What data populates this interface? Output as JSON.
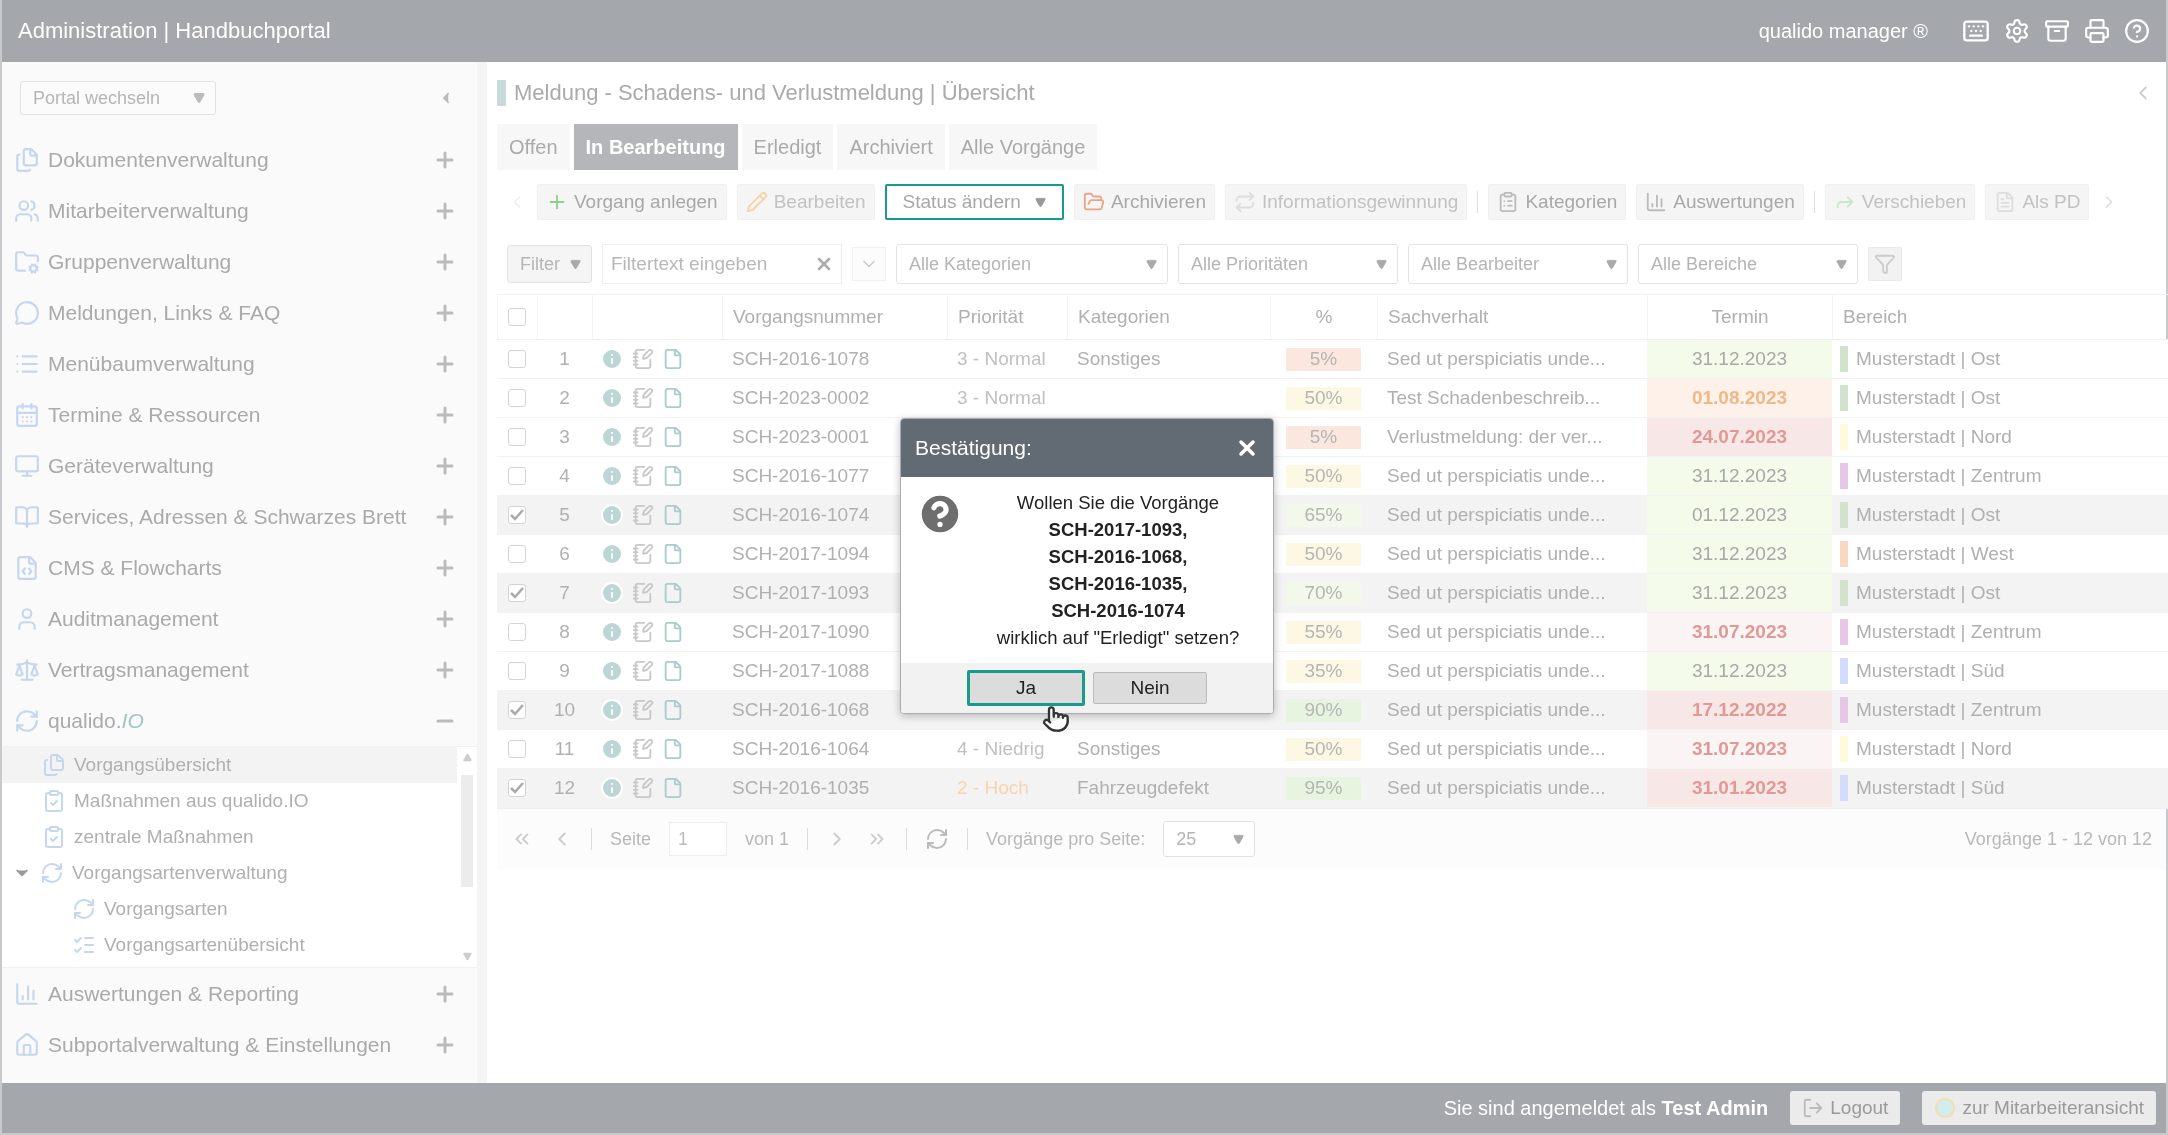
{
  "header": {
    "title": "Administration | Handbuchportal",
    "product": "qualido manager ®"
  },
  "sidebar": {
    "portal_select": "Portal wechseln",
    "items": [
      {
        "label": "Dokumentenverwaltung",
        "expanded": false
      },
      {
        "label": "Mitarbeiterverwaltung",
        "expanded": false
      },
      {
        "label": "Gruppenverwaltung",
        "expanded": false
      },
      {
        "label": "Meldungen, Links & FAQ",
        "expanded": false
      },
      {
        "label": "Menübaumverwaltung",
        "expanded": false
      },
      {
        "label": "Termine & Ressourcen",
        "expanded": false
      },
      {
        "label": "Geräteverwaltung",
        "expanded": false
      },
      {
        "label": "Services, Adressen & Schwarzes Brett",
        "expanded": false
      },
      {
        "label": "CMS & Flowcharts",
        "expanded": false
      },
      {
        "label": "Auditmanagement",
        "expanded": false
      },
      {
        "label": "Vertragsmanagement",
        "expanded": false
      },
      {
        "label": "qualido.*IO*",
        "expanded": true,
        "children": [
          {
            "label": "Vorgangsübersicht",
            "selected": true
          },
          {
            "label": "Maßnahmen aus qualido.IO",
            "selected": false
          },
          {
            "label": "zentrale Maßnahmen",
            "selected": false
          },
          {
            "label": "Vorgangsartenverwaltung",
            "selected": false,
            "expanded": true,
            "children": [
              {
                "label": "Vorgangsarten",
                "selected": false
              },
              {
                "label": "Vorgangsartenübersicht",
                "selected": false
              }
            ]
          }
        ]
      },
      {
        "label": "Auswertungen & Reporting",
        "expanded": false
      },
      {
        "label": "Subportalverwaltung & Einstellungen",
        "expanded": false
      }
    ]
  },
  "page_title": "Meldung - Schadens- und Verlustmeldung | Übersicht",
  "tabs": [
    {
      "label": "Offen",
      "selected": false
    },
    {
      "label": "In Bearbeitung",
      "selected": true
    },
    {
      "label": "Erledigt",
      "selected": false
    },
    {
      "label": "Archiviert",
      "selected": false
    },
    {
      "label": "Alle Vorgänge",
      "selected": false
    }
  ],
  "toolbar": {
    "groups": [
      [
        {
          "label": "Vorgang anlegen",
          "disabled": false,
          "focused": false,
          "dropdown": false
        },
        {
          "label": "Bearbeiten",
          "disabled": true,
          "focused": false,
          "dropdown": false
        },
        {
          "label": "Status ändern",
          "disabled": false,
          "focused": true,
          "dropdown": true
        },
        {
          "label": "Archivieren",
          "disabled": false,
          "focused": false,
          "dropdown": false
        },
        {
          "label": "Informationsgewinnung",
          "disabled": true,
          "focused": false,
          "dropdown": false
        }
      ],
      [
        {
          "label": "Kategorien",
          "disabled": false,
          "focused": false,
          "dropdown": false
        },
        {
          "label": "Auswertungen",
          "disabled": false,
          "focused": false,
          "dropdown": false
        }
      ],
      [
        {
          "label": "Verschieben",
          "disabled": true,
          "focused": false,
          "dropdown": false
        },
        {
          "label": "Als PD",
          "disabled": true,
          "focused": false,
          "dropdown": false
        }
      ]
    ]
  },
  "filters": {
    "filter_button": "Filter",
    "text_placeholder": "Filtertext eingeben",
    "selects": [
      "Alle Kategorien",
      "Alle Prioritäten",
      "Alle Bearbeiter",
      "Alle Bereiche"
    ]
  },
  "table": {
    "all_selected": false,
    "columns": [
      "Vorgangsnummer",
      "Priorität",
      "Kategorien",
      "%",
      "Sachverhalt",
      "Termin",
      "Bereich"
    ],
    "rows": [
      {
        "selected": false,
        "number": "1",
        "id": "SCH-2016-1078",
        "priority": {
          "text": "3 - Normal",
          "kind": "normal"
        },
        "category": "Sonstiges",
        "percent": {
          "text": "5%",
          "color": "#fbe7de"
        },
        "summary": "Sed ut perspiciatis unde...",
        "due": {
          "text": "31.12.2023",
          "kind": "ok",
          "color": "#f4fbea"
        },
        "area": {
          "text": "Musterstadt | Ost",
          "color": "#d3e2cd"
        }
      },
      {
        "selected": false,
        "number": "2",
        "id": "SCH-2023-0002",
        "priority": {
          "text": "3 - Normal",
          "kind": "normal"
        },
        "percent": {
          "text": "50%",
          "color": "#fdf8e4"
        },
        "summary": "Test Schadenbeschreib...",
        "due": {
          "text": "01.08.2023",
          "kind": "soon",
          "color": "#fdf1ea"
        },
        "area": {
          "text": "Musterstadt | Ost",
          "color": "#d3e2cd"
        }
      },
      {
        "selected": false,
        "number": "3",
        "id": "SCH-2023-0001",
        "percent": {
          "text": "5%",
          "color": "#fbe7de"
        },
        "summary": "Verlustmeldung: der ver...",
        "due": {
          "text": "24.07.2023",
          "kind": "overdue",
          "color": "#f8e7e7"
        },
        "area": {
          "text": "Musterstadt | Nord",
          "color": "#fdfbdc"
        }
      },
      {
        "selected": false,
        "number": "4",
        "id": "SCH-2016-1077",
        "percent": {
          "text": "50%",
          "color": "#fdf8e4"
        },
        "summary": "Sed ut perspiciatis unde...",
        "due": {
          "text": "31.12.2023",
          "kind": "ok",
          "color": "#f4fbea"
        },
        "area": {
          "text": "Musterstadt | Zentrum",
          "color": "#e6c8e6"
        }
      },
      {
        "selected": true,
        "number": "5",
        "id": "SCH-2016-1074",
        "percent": {
          "text": "65%",
          "color": "#f2f8ea"
        },
        "summary": "Sed ut perspiciatis unde...",
        "due": {
          "text": "01.12.2023",
          "kind": "ok",
          "color": "#f4fbea"
        },
        "area": {
          "text": "Musterstadt | Ost",
          "color": "#d3e2cd"
        }
      },
      {
        "selected": false,
        "number": "6",
        "id": "SCH-2017-1094",
        "percent": {
          "text": "50%",
          "color": "#fdf8e4"
        },
        "summary": "Sed ut perspiciatis unde...",
        "due": {
          "text": "31.12.2023",
          "kind": "ok",
          "color": "#f4fbea"
        },
        "area": {
          "text": "Musterstadt | West",
          "color": "#f8d8c0"
        }
      },
      {
        "selected": true,
        "number": "7",
        "id": "SCH-2017-1093",
        "percent": {
          "text": "70%",
          "color": "#f2f8ea"
        },
        "summary": "Sed ut perspiciatis unde...",
        "due": {
          "text": "31.12.2023",
          "kind": "ok",
          "color": "#f4fbea"
        },
        "area": {
          "text": "Musterstadt | Ost",
          "color": "#d3e2cd"
        }
      },
      {
        "selected": false,
        "number": "8",
        "id": "SCH-2017-1090",
        "percent": {
          "text": "55%",
          "color": "#fdf8e4"
        },
        "summary": "Sed ut perspiciatis unde...",
        "due": {
          "text": "31.07.2023",
          "kind": "overdue",
          "color": "#faf4f4"
        },
        "area": {
          "text": "Musterstadt | Zentrum",
          "color": "#e6c8e6"
        }
      },
      {
        "selected": false,
        "number": "9",
        "id": "SCH-2017-1088",
        "percent": {
          "text": "35%",
          "color": "#fdf8e4"
        },
        "summary": "Sed ut perspiciatis unde...",
        "due": {
          "text": "31.12.2023",
          "kind": "ok",
          "color": "#f4fbea"
        },
        "area": {
          "text": "Musterstadt | Süd",
          "color": "#d3dcfb"
        }
      },
      {
        "selected": true,
        "number": "10",
        "id": "SCH-2016-1068",
        "percent": {
          "text": "90%",
          "color": "#e6f4e0"
        },
        "summary": "Sed ut perspiciatis unde...",
        "due": {
          "text": "17.12.2022",
          "kind": "overdue",
          "color": "#f8e7e7"
        },
        "area": {
          "text": "Musterstadt | Zentrum",
          "color": "#e6c8e6"
        }
      },
      {
        "selected": false,
        "number": "11",
        "id": "SCH-2016-1064",
        "priority": {
          "text": "4 - Niedrig",
          "kind": "normal"
        },
        "category": "Sonstiges",
        "percent": {
          "text": "50%",
          "color": "#fdf8e4"
        },
        "summary": "Sed ut perspiciatis unde...",
        "due": {
          "text": "31.07.2023",
          "kind": "overdue",
          "color": "#faf4f4"
        },
        "area": {
          "text": "Musterstadt | Nord",
          "color": "#fdfbdc"
        }
      },
      {
        "selected": true,
        "number": "12",
        "id": "SCH-2016-1035",
        "priority": {
          "text": "2 - Hoch",
          "kind": "high"
        },
        "category": "Fahrzeugdefekt",
        "percent": {
          "text": "95%",
          "color": "#e6f4e0"
        },
        "summary": "Sed ut perspiciatis unde...",
        "due": {
          "text": "31.01.2023",
          "kind": "overdue",
          "color": "#f8e7e7"
        },
        "area": {
          "text": "Musterstadt | Süd",
          "color": "#d3dcfb"
        }
      }
    ]
  },
  "pagination": {
    "page_label": "Seite",
    "page": "1",
    "of": "von 1",
    "per_page_label": "Vorgänge pro Seite:",
    "per_page": "25",
    "summary": "Vorgänge 1 - 12 von 12"
  },
  "footer": {
    "login_text": "Sie sind angemeldet als **Test Admin**",
    "logout": "Logout",
    "switch_view": "zur Mitarbeiteransicht"
  },
  "dialog": {
    "title": "Bestätigung:",
    "message": "Wollen Sie die Vorgänge\n**SCH-2017-1093,**\n**SCH-2016-1068,**\n**SCH-2016-1035,**\n**SCH-2016-1074**\nwirklich auf \"Erledigt\" setzen?",
    "buttons": [
      {
        "label": "Ja",
        "focused": true
      },
      {
        "label": "Nein",
        "focused": false
      }
    ]
  }
}
